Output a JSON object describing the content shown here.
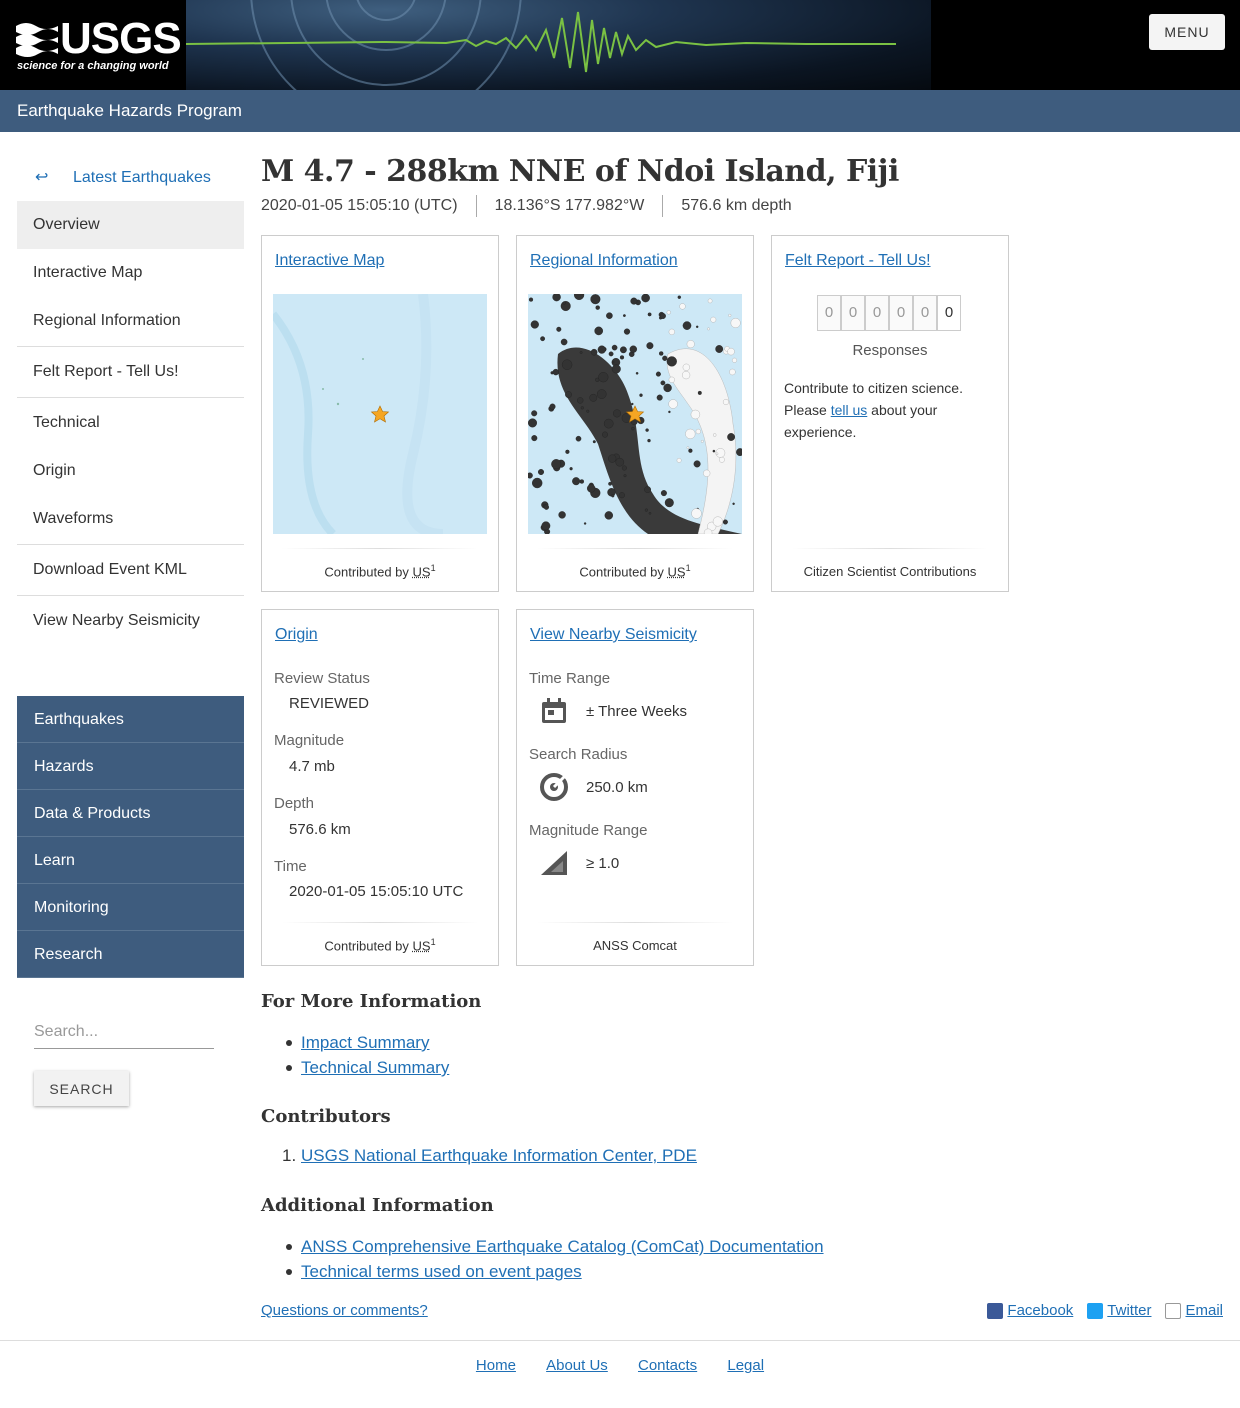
{
  "header": {
    "logo_text": "USGS",
    "logo_tagline": "science for a changing world",
    "menu_label": "MENU",
    "program": "Earthquake Hazards Program"
  },
  "sidebar": {
    "back_label": "Latest Earthquakes",
    "back_icon": "left-arrow-icon",
    "items": [
      {
        "label": "Overview",
        "active": true
      },
      {
        "label": "Interactive Map"
      },
      {
        "label": "Regional Information"
      },
      {
        "label": "Felt Report - Tell Us!"
      },
      {
        "label": "Technical"
      },
      {
        "label": "Origin"
      },
      {
        "label": "Waveforms"
      },
      {
        "label": "Download Event KML"
      },
      {
        "label": "View Nearby Seismicity"
      }
    ],
    "site_nav": [
      "Earthquakes",
      "Hazards",
      "Data & Products",
      "Learn",
      "Monitoring",
      "Research"
    ],
    "search_placeholder": "Search...",
    "search_button": "SEARCH"
  },
  "event": {
    "title": "M 4.7 - 288km NNE of Ndoi Island, Fiji",
    "time": "2020-01-05 15:05:10 (UTC)",
    "location": "18.136°S 177.982°W",
    "depth": "576.6 km depth"
  },
  "cards": {
    "map": {
      "title": "Interactive Map",
      "contrib_prefix": "Contributed by",
      "contrib_net": "US",
      "contrib_ref": "1"
    },
    "regional": {
      "title": "Regional Information",
      "contrib_prefix": "Contributed by",
      "contrib_net": "US",
      "contrib_ref": "1"
    },
    "felt": {
      "title": "Felt Report - Tell Us!",
      "counter": [
        "0",
        "0",
        "0",
        "0",
        "0",
        "0"
      ],
      "responses_label": "Responses",
      "text_before": "Contribute to citizen science. Please ",
      "link": "tell us",
      "text_after": " about your experience.",
      "footer": "Citizen Scientist Contributions"
    },
    "origin": {
      "title": "Origin",
      "review_status_label": "Review Status",
      "review_status": "REVIEWED",
      "magnitude_label": "Magnitude",
      "magnitude": "4.7 mb",
      "depth_label": "Depth",
      "depth": "576.6 km",
      "time_label": "Time",
      "time": "2020-01-05 15:05:10 UTC",
      "contrib_prefix": "Contributed by",
      "contrib_net": "US",
      "contrib_ref": "1"
    },
    "seismicity": {
      "title": "View Nearby Seismicity",
      "time_range_label": "Time Range",
      "time_range": "± Three Weeks",
      "time_icon": "calendar-icon",
      "radius_label": "Search Radius",
      "radius": "250.0 km",
      "radius_icon": "target-icon",
      "mag_range_label": "Magnitude Range",
      "mag_range": "≥ 1.0",
      "mag_icon": "magnitude-ramp-icon",
      "footer": "ANSS Comcat"
    }
  },
  "more_info": {
    "heading": "For More Information",
    "links": [
      "Impact Summary",
      "Technical Summary"
    ]
  },
  "contributors": {
    "heading": "Contributors",
    "items": [
      {
        "num": "1.",
        "label": "USGS National Earthquake Information Center, PDE"
      }
    ]
  },
  "additional": {
    "heading": "Additional Information",
    "links": [
      "ANSS Comprehensive Earthquake Catalog (ComCat) Documentation",
      "Technical terms used on event pages"
    ]
  },
  "questions": "Questions or comments?",
  "share": [
    {
      "label": "Facebook",
      "icon": "facebook-icon",
      "color": "#3b5998"
    },
    {
      "label": "Twitter",
      "icon": "twitter-icon",
      "color": "#1da1f2"
    },
    {
      "label": "Email",
      "icon": "email-icon",
      "color": "#999999"
    }
  ],
  "footer": [
    "Home",
    "About Us",
    "Contacts",
    "Legal"
  ],
  "colors": {
    "nav_blue": "#3e5c7e",
    "link": "#1f6fb5",
    "epicenter_star": "#f5a623"
  }
}
